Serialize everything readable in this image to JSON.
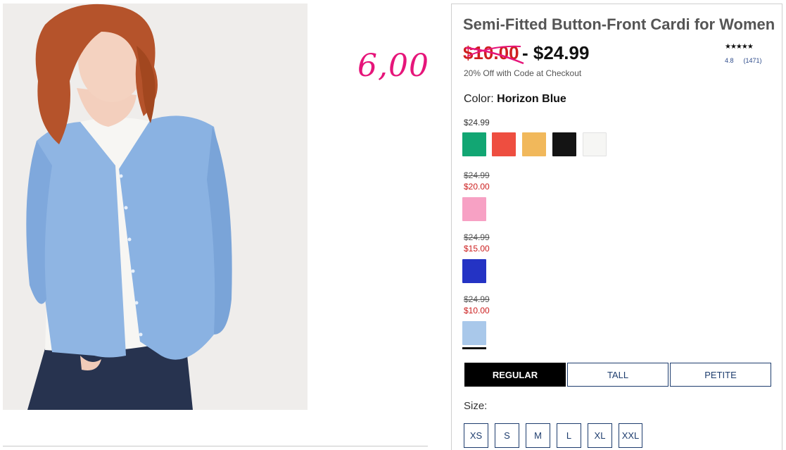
{
  "annotation": {
    "text": "6,00"
  },
  "product": {
    "title": "Semi-Fitted Button-Front Cardi for Women",
    "price_old": "$10.00",
    "price_sep": " - ",
    "price_new": "$24.99",
    "promo": "20% Off with Code at Checkout",
    "rating": {
      "stars": "★★★★★",
      "score": "4.8",
      "count": "(1471)"
    }
  },
  "color": {
    "label": "Color:",
    "selected": "Horizon Blue"
  },
  "color_groups": [
    {
      "price": "$24.99",
      "swatches": [
        {
          "name": "green",
          "hex": "#12a673"
        },
        {
          "name": "coral",
          "hex": "#ee4e40"
        },
        {
          "name": "mustard",
          "hex": "#f1b85b"
        },
        {
          "name": "black",
          "hex": "#141414"
        },
        {
          "name": "white",
          "hex": "#f6f6f4"
        }
      ]
    },
    {
      "was": "$24.99",
      "sale": "$20.00",
      "swatches": [
        {
          "name": "pink",
          "hex": "#f7a1c4"
        }
      ]
    },
    {
      "was": "$24.99",
      "sale": "$15.00",
      "swatches": [
        {
          "name": "cobalt",
          "hex": "#2433c4"
        }
      ]
    },
    {
      "was": "$24.99",
      "sale": "$10.00",
      "swatches": [
        {
          "name": "horizon-blue",
          "hex": "#a9c8ea"
        }
      ]
    }
  ],
  "fits": {
    "regular": "REGULAR",
    "tall": "TALL",
    "petite": "PETITE",
    "selected": "regular"
  },
  "size": {
    "label": "Size:",
    "options": [
      "XS",
      "S",
      "M",
      "L",
      "XL",
      "XXL"
    ]
  },
  "colors": {
    "accent_navy": "#1e3d6e",
    "sale_red": "#cc1e1e",
    "annotation_pink": "#e6157a"
  }
}
